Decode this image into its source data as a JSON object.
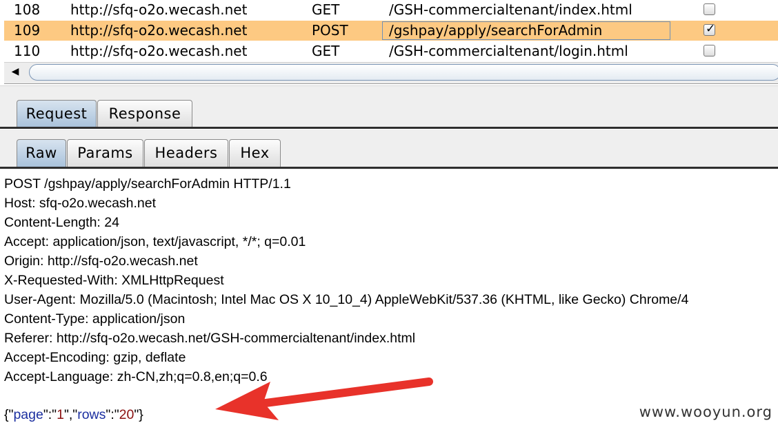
{
  "table": {
    "rows": [
      {
        "num": "108",
        "host": "http://sfq-o2o.wecash.net",
        "method": "GET",
        "url": "/GSH-commercialtenant/index.html",
        "checked": false
      },
      {
        "num": "109",
        "host": "http://sfq-o2o.wecash.net",
        "method": "POST",
        "url": "/gshpay/apply/searchForAdmin",
        "checked": true
      },
      {
        "num": "110",
        "host": "http://sfq-o2o.wecash.net",
        "method": "GET",
        "url": "/GSH-commercialtenant/login.html",
        "checked": false
      }
    ],
    "scroll_left_icon": "◀"
  },
  "tabs_main": [
    "Request",
    "Response"
  ],
  "tabs_sub": [
    "Raw",
    "Params",
    "Headers",
    "Hex"
  ],
  "request_lines": [
    "POST /gshpay/apply/searchForAdmin HTTP/1.1",
    "Host: sfq-o2o.wecash.net",
    "Content-Length: 24",
    "Accept: application/json, text/javascript, */*; q=0.01",
    "Origin: http://sfq-o2o.wecash.net",
    "X-Requested-With: XMLHttpRequest",
    "User-Agent: Mozilla/5.0 (Macintosh; Intel Mac OS X 10_10_4) AppleWebKit/537.36 (KHTML, like Gecko) Chrome/4",
    "Content-Type: application/json",
    "Referer: http://sfq-o2o.wecash.net/GSH-commercialtenant/index.html",
    "Accept-Encoding: gzip, deflate",
    "Accept-Language: zh-CN,zh;q=0.8,en;q=0.6"
  ],
  "body": {
    "open": "{\"",
    "k1": "page",
    "sep1": "\":\"",
    "v1": "1",
    "sep2": "\",\"",
    "k2": "rows",
    "sep3": "\":\"",
    "v2": "20",
    "close": "\"}"
  },
  "watermark": "www.wooyun.org",
  "colors": {
    "selected_row": "#fdc982",
    "arrow": "#e8322a",
    "json_key": "#1b2fa0",
    "json_value": "#8b1010"
  }
}
